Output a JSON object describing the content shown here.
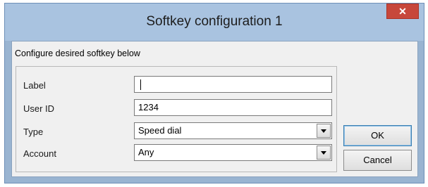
{
  "window": {
    "title": "Softkey configuration 1",
    "close_glyph": "✕"
  },
  "instruction": "Configure desired softkey below",
  "form": {
    "label": {
      "caption": "Label",
      "value": ""
    },
    "user_id": {
      "caption": "User ID",
      "value": "1234"
    },
    "type": {
      "caption": "Type",
      "selected": "Speed dial"
    },
    "account": {
      "caption": "Account",
      "selected": "Any"
    }
  },
  "buttons": {
    "ok": "OK",
    "cancel": "Cancel"
  }
}
